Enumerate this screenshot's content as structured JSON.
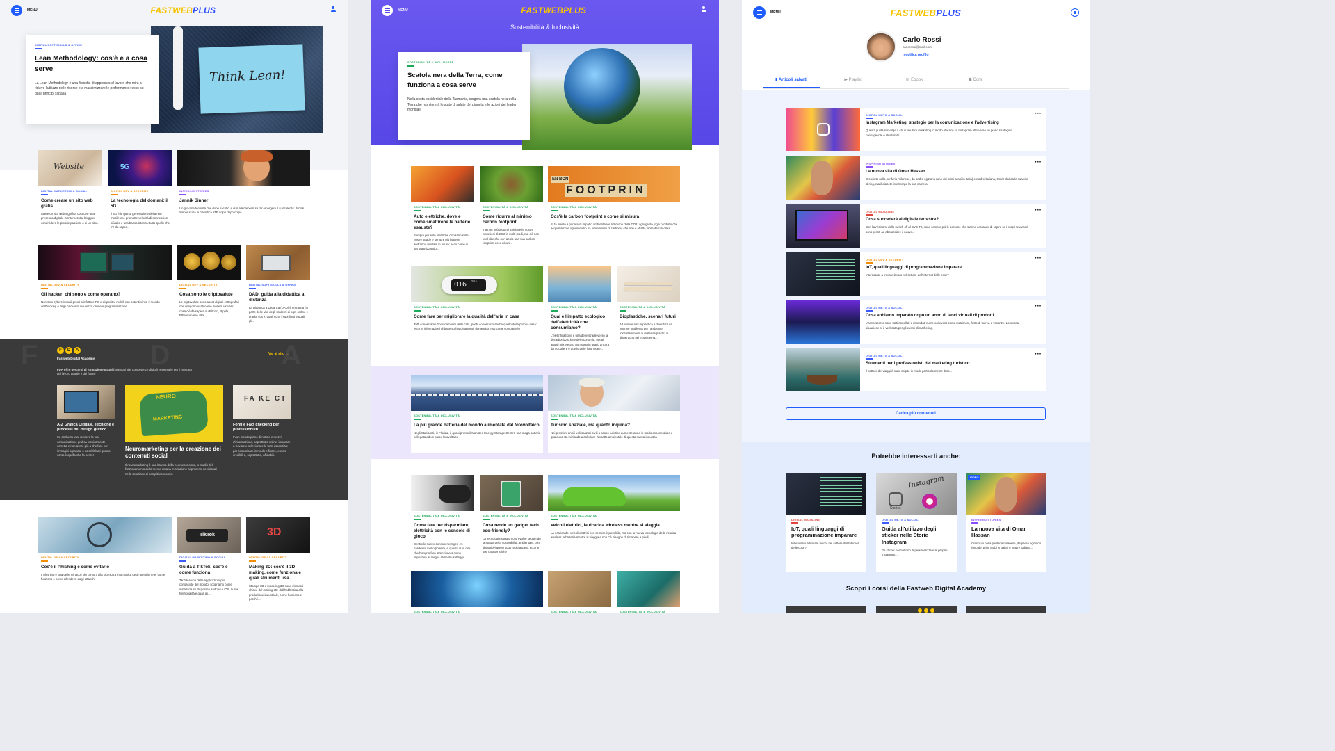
{
  "logo": {
    "part1": "FASTWEB",
    "part2": "PLUS"
  },
  "menu_label": "MENU",
  "left": {
    "hero": {
      "category": "DIGITAL SOFT SKILLS & OFFICE",
      "title": "Lean Methodology: cos'è e a cosa serve",
      "desc": "La Lean Methodology è una filosofia di approccio al lavoro che mira a ridurre l'utilizzo delle risorse e a massimizzare le performance: ecco su quali principi si basa",
      "img_text": "Think Lean!"
    },
    "grid1": [
      {
        "category": "DIGITAL MARKETING & SOCIAL",
        "title": "Come creare un sito web gratis",
        "desc": "Avere un sito web significa costruire una presenza digitale in Internet: dal blog per condividere le proprie passioni o di un sito..."
      },
      {
        "category": "DIGITAL DEV & SECURITY",
        "title": "La tecnologia del domani: il 5G",
        "desc": "Il 5G è la quinta generazione della rete mobile che promette velocità di connessioni più alte e una bassa latenza: tutto quello che c'è da saper..."
      },
      {
        "category": "INSPIRING STORIES",
        "title": "Jannik Sinner",
        "desc": "Un giovane tennista che dopo sacrifici e duri allenamenti sa far emergere il suo talento: Jannik Sinner scala la classifica ATP colpo dopo colpo"
      }
    ],
    "grid2": [
      {
        "category": "DIGITAL DEV & SECURITY",
        "title": "Gli hacker: chi sono e come operano?",
        "desc": "Non solo cybercriminali pronti a infettare PC e dispositivi mobili con potenti virus: il mondo dell'hacking e degli hacker la sicurezza online e programmazione"
      },
      {
        "category": "DIGITAL DEV & SECURITY",
        "title": "Cosa sono le criptovalute",
        "desc": "Le criptovalute sono asset digitali crittografati che vengono usati come moneta virtuale: cosa c'è da sapere su Bitcoin, Ripple, Ethereum e le altre"
      },
      {
        "category": "DIGITAL SOFT SKILLS & OFFICE",
        "title": "DAD: guida alla didattica a distanza",
        "desc": "La Didattica a Distanza (DAD) è entrata a far parte delle vite degli studenti di ogni ordine e grado: cos'è, quali sono i suoi limiti e quali gli..."
      }
    ],
    "fda": {
      "logo_letters": "F D A",
      "logo_caption": "Fastweb Digital Academy",
      "link": "Vai al sito",
      "intro_bold": "FDA offre percorsi di formazione gratuiti",
      "intro": " orientati alle competenze digitali necessarie per il mercato del lavoro attuale e del futuro",
      "items": [
        {
          "title": "A-Z Grafica Digitale. Tecniche e processi nel design grafico",
          "desc": "Se anche tu vuoi rendere la tua comunicazione grafica tecnicamente corretta e non avere più a che fare con immagini sgranate o colori falsati questo corso è quello che fa per te!"
        },
        {
          "title": "Neuromarketing per la creazione dei contenuti social",
          "desc": "Il neuromarketing è una branca della neuroeconomia, lo studio del funzionamento della mente umana in relazione ai processi decisionali nella soluzione di compiti economici.",
          "img_line1": "NEURO",
          "img_line2": "MARKETING"
        },
        {
          "title": "Fonti e Fact checking per professionisti",
          "desc": "In un mondo pieno di notizie e mezzi d'informazione, soprattutto online, imparare a trovare e selezionare le fonti essenziale per comunicare in modo efficace, essere credibili e, soprattutto, affidabili.",
          "img_text": "FA KE CT"
        }
      ]
    },
    "grid3": [
      {
        "category": "DIGITAL DEV & SECURITY",
        "title": "Cos'è il Phishing e come evitarlo",
        "desc": "Il phishing è una delle minacce più comuni alla sicurezza informatica degli utenti in rete: come funziona e come difendersi dagli attacchi"
      },
      {
        "category": "DIGITAL MARKETING & SOCIAL",
        "title": "Guida a TikTok: cos'è e come funziona",
        "desc": "TikTok è una delle applicazioni più conosciute del mondo: scopriamo come installarla su dispositivi Android e iOS, le sue funzionalità e quali gli...",
        "img_text": "TikTok"
      },
      {
        "category": "DIGITAL DEV & SECURITY",
        "title": "Making 3D: cos'è il 3D making, come funziona e quali strumenti usa",
        "desc": "Stampa 3D e modeling 3D sono elementi chiave del making 3D: dall'hobbistica alla produzione industriale, come funziona e perché...",
        "img_text": "3D"
      }
    ]
  },
  "middle": {
    "section_title": "Sostenibilità & Inclusività",
    "hero": {
      "category": "SOSTENIBILITÀ & INCLUSIVITÀ",
      "title": "Scatola nera della Terra, come funziona a cosa serve",
      "desc": "Nella costa occidentale della Tasmania, sorgerà una scatola nera della Terra che monitorerà lo stato di salute del pianeta e le azioni dei leader mondiali"
    },
    "row1": [
      {
        "category": "SOSTENIBILITÀ & INCLUSIVITÀ",
        "title": "Auto elettriche, dove e come smaltirene le batterie esauste?",
        "desc": "Sempre più auto elettriche circolano sulle nostre strade e sempre più batterie andranno riciclate in futuro: ecco come si sta organizzando..."
      },
      {
        "category": "SOSTENIBILITÀ & INCLUSIVITÀ",
        "title": "Come ridurre al minimo carbon footprint",
        "desc": "Internet può aiutarci a ridurre le nostre emissioni di CO2 in molti modi, ma ciò non vuol dire che non abbia una sua carbon footprint: ecco alcuni..."
      },
      {
        "category": "SOSTENIBILITÀ & INCLUSIVITÀ",
        "title": "Cos'è la carbon footprint e come si misura",
        "desc": "Si fa presto a parlare di impatto ambientale e riduzione della CO2: ogni gesto, ogni prodotto che acquistiamo e ogni servizio ha un'impronta di carbonio che non è affatto facile da calcolare",
        "img_text": "FOOTPRIN",
        "img_sub": "EN BON"
      }
    ],
    "row2": [
      {
        "category": "SOSTENIBILITÀ & INCLUSIVITÀ",
        "title": "Come fare per migliorare la qualità dell'aria in casa",
        "desc": "Tutti conosciamo l'inquinamento delle città, pochi conoscono anche quello della propria casa: ecco le informazioni di base sull'inquinamento domestico e su come combatterlo",
        "img_text": "016",
        "img_sub": "PM2.5"
      },
      {
        "category": "SOSTENIBILITÀ & INCLUSIVITÀ",
        "title": "Qual è l'impatto ecologico dell'elettricità che consumiamo?",
        "desc": "L'elettrificazione è una delle strade verso la decarbonizzazione dell'economia, ma gli attuali mix elettrici non sono in grado ancora da sciogliere è quello delle fonti usate..."
      },
      {
        "category": "SOSTENIBILITÀ & INCLUSIVITÀ",
        "title": "Bioplastiche, scenari futuri",
        "desc": "Ad essere ami la plastica è diventata un enorme problema per l'ambiente: microframmenti di materiali plastici si disperdono nel ecosistema..."
      }
    ],
    "band": [
      {
        "category": "SOSTENIBILITÀ & INCLUSIVITÀ",
        "title": "La più grande batteria del mondo alimentata dal fotovoltaico",
        "desc": "Negli Stati Uniti, in Florida, è quasi pronto il Manatee Energy Storage Center: una mega batteria collegata ad un parco fotovoltaico"
      },
      {
        "category": "SOSTENIBILITÀ & INCLUSIVITÀ",
        "title": "Turismo spaziale, ma quanto inquina?",
        "desc": "Nei prossimi anni i voli spaziali civili a scopo turistico aumenteranno in modo esponenziale e qualcuno sta iniziando a calcolare l'impatto ambientale di questa nuova industria"
      }
    ],
    "row3": [
      {
        "category": "SOSTENIBILITÀ & INCLUSIVITÀ",
        "title": "Come fare per risparmiare elettricità con le console di gioco",
        "desc": "Dentro le nuove console next-gen c'è hardware molto potente, e questo vuol dire che bisogna fare attenzione a come impostare al meglio alimenti i settaggi..."
      },
      {
        "category": "SOSTENIBILITÀ & INCLUSIVITÀ",
        "title": "Cosa rende un gadget tech eco-friendly?",
        "desc": "La tecnologia soggiorno si evolve seguendo la strada della sostenibilità ambientale, con dispositivi green sotto molti aspetti: ecco le sue caratteristiche"
      },
      {
        "category": "SOSTENIBILITÀ & INCLUSIVITÀ",
        "title": "Veicoli elettrici, la ricarica wireless mentre si viaggia",
        "desc": "La ricarica dei veicoli elettrici non sempre è possibile, ma con la nuova tecnologia della ricarica wireless la batteria mentre si viaggia e non c'è bisogno di rimanere a piedi"
      }
    ],
    "row4": [
      {
        "category": "SOSTENIBILITÀ & INCLUSIVITÀ"
      },
      {
        "category": "SOSTENIBILITÀ & INCLUSIVITÀ"
      },
      {
        "category": "SOSTENIBILITÀ & INCLUSIVITÀ"
      }
    ]
  },
  "right": {
    "profile": {
      "name": "Carlo Rossi",
      "email": "carlorossi@mail.com",
      "edit": "modifica profilo"
    },
    "tabs": [
      {
        "label": "Articoli salvati"
      },
      {
        "label": "Playlist"
      },
      {
        "label": "Ebook"
      },
      {
        "label": "Corsi"
      }
    ],
    "saved": [
      {
        "category": "DIGITAL MKTG & SOCIAL",
        "title": "Instagram Marketing: strategie per la comunicazione e l'advertising",
        "desc": "Questa guida si rivolge a chi vuole fare marketing in modo efficace su Instagram attraverso un piano strategico consapevole e strutturato."
      },
      {
        "category": "INSPIRING STORIES",
        "title": "La nuova vita di Omar Hassan",
        "desc": "Cresciuto nella periferia milanese, da padre egiziano (uno dei primi arabi in Italia) e madre italiana, Omar dedica la sua vita al ring, ma il diabete interrompe la sua carriera."
      },
      {
        "category": "DIGITAL MAGAZINE",
        "title": "Cosa succederà al digitale terrestre?",
        "desc": "Con l'avvicinarsi dello switch off al DVB-T2, sono sempre più le persone che stanno cercando di capire se i propri televisori sono pronti ad abbracciare il nuovo..."
      },
      {
        "category": "DIGITAL DEV & SECURITY",
        "title": "IoT, quali linguaggi di programmazione imparare",
        "desc": "Interessato a trovare lavoro nel settore dell'Internet delle cose?"
      },
      {
        "category": "DIGITAL MKTG & SOCIAL",
        "title": "Cosa abbiamo imparato dopo un anno di lanci virtuali di prodotti",
        "desc": "L'anno scorso sono stati annullati e rimandati numerosi eventi come matrimoni, feste di laurea e vacanze. La stessa situazione si è verificata per gli eventi di marketing."
      },
      {
        "category": "DIGITAL MKTG & SOCIAL",
        "title": "Strumenti per i professionisti del marketing turistico",
        "desc": "Il settore dei viaggi è stato colpito in modo particolarmente duro..."
      }
    ],
    "load_more": "Carica più contenuti",
    "suggest_title": "Potrebbe interessarti anche:",
    "suggest": [
      {
        "category": "DIGITAL MAGAZINE",
        "title": "IoT, quali linguaggi di programmazione imparare",
        "desc": "Interessato a trovare lavoro nel settore dell'Internet delle cose?"
      },
      {
        "category": "DIGITAL MKTG & SOCIAL",
        "title": "Guida all'utilizzo degli sticker nelle Storie Instagram",
        "desc": "Gli sticker permettono di personalizzare le proprie Instagram...",
        "img_text": "Instagram",
        "img_sub": "Stories"
      },
      {
        "category": "INSPIRING STORIES",
        "title": "La nuova vita di Omar Hassan",
        "desc": "Cresciuto nella periferia milanese, da padre egiziano (uno dei primi arabi in Italia) e madre italiana...",
        "badge": "VIDEO"
      }
    ],
    "academy_title": "Scopri i corsi della Fastweb Digital Academy"
  }
}
